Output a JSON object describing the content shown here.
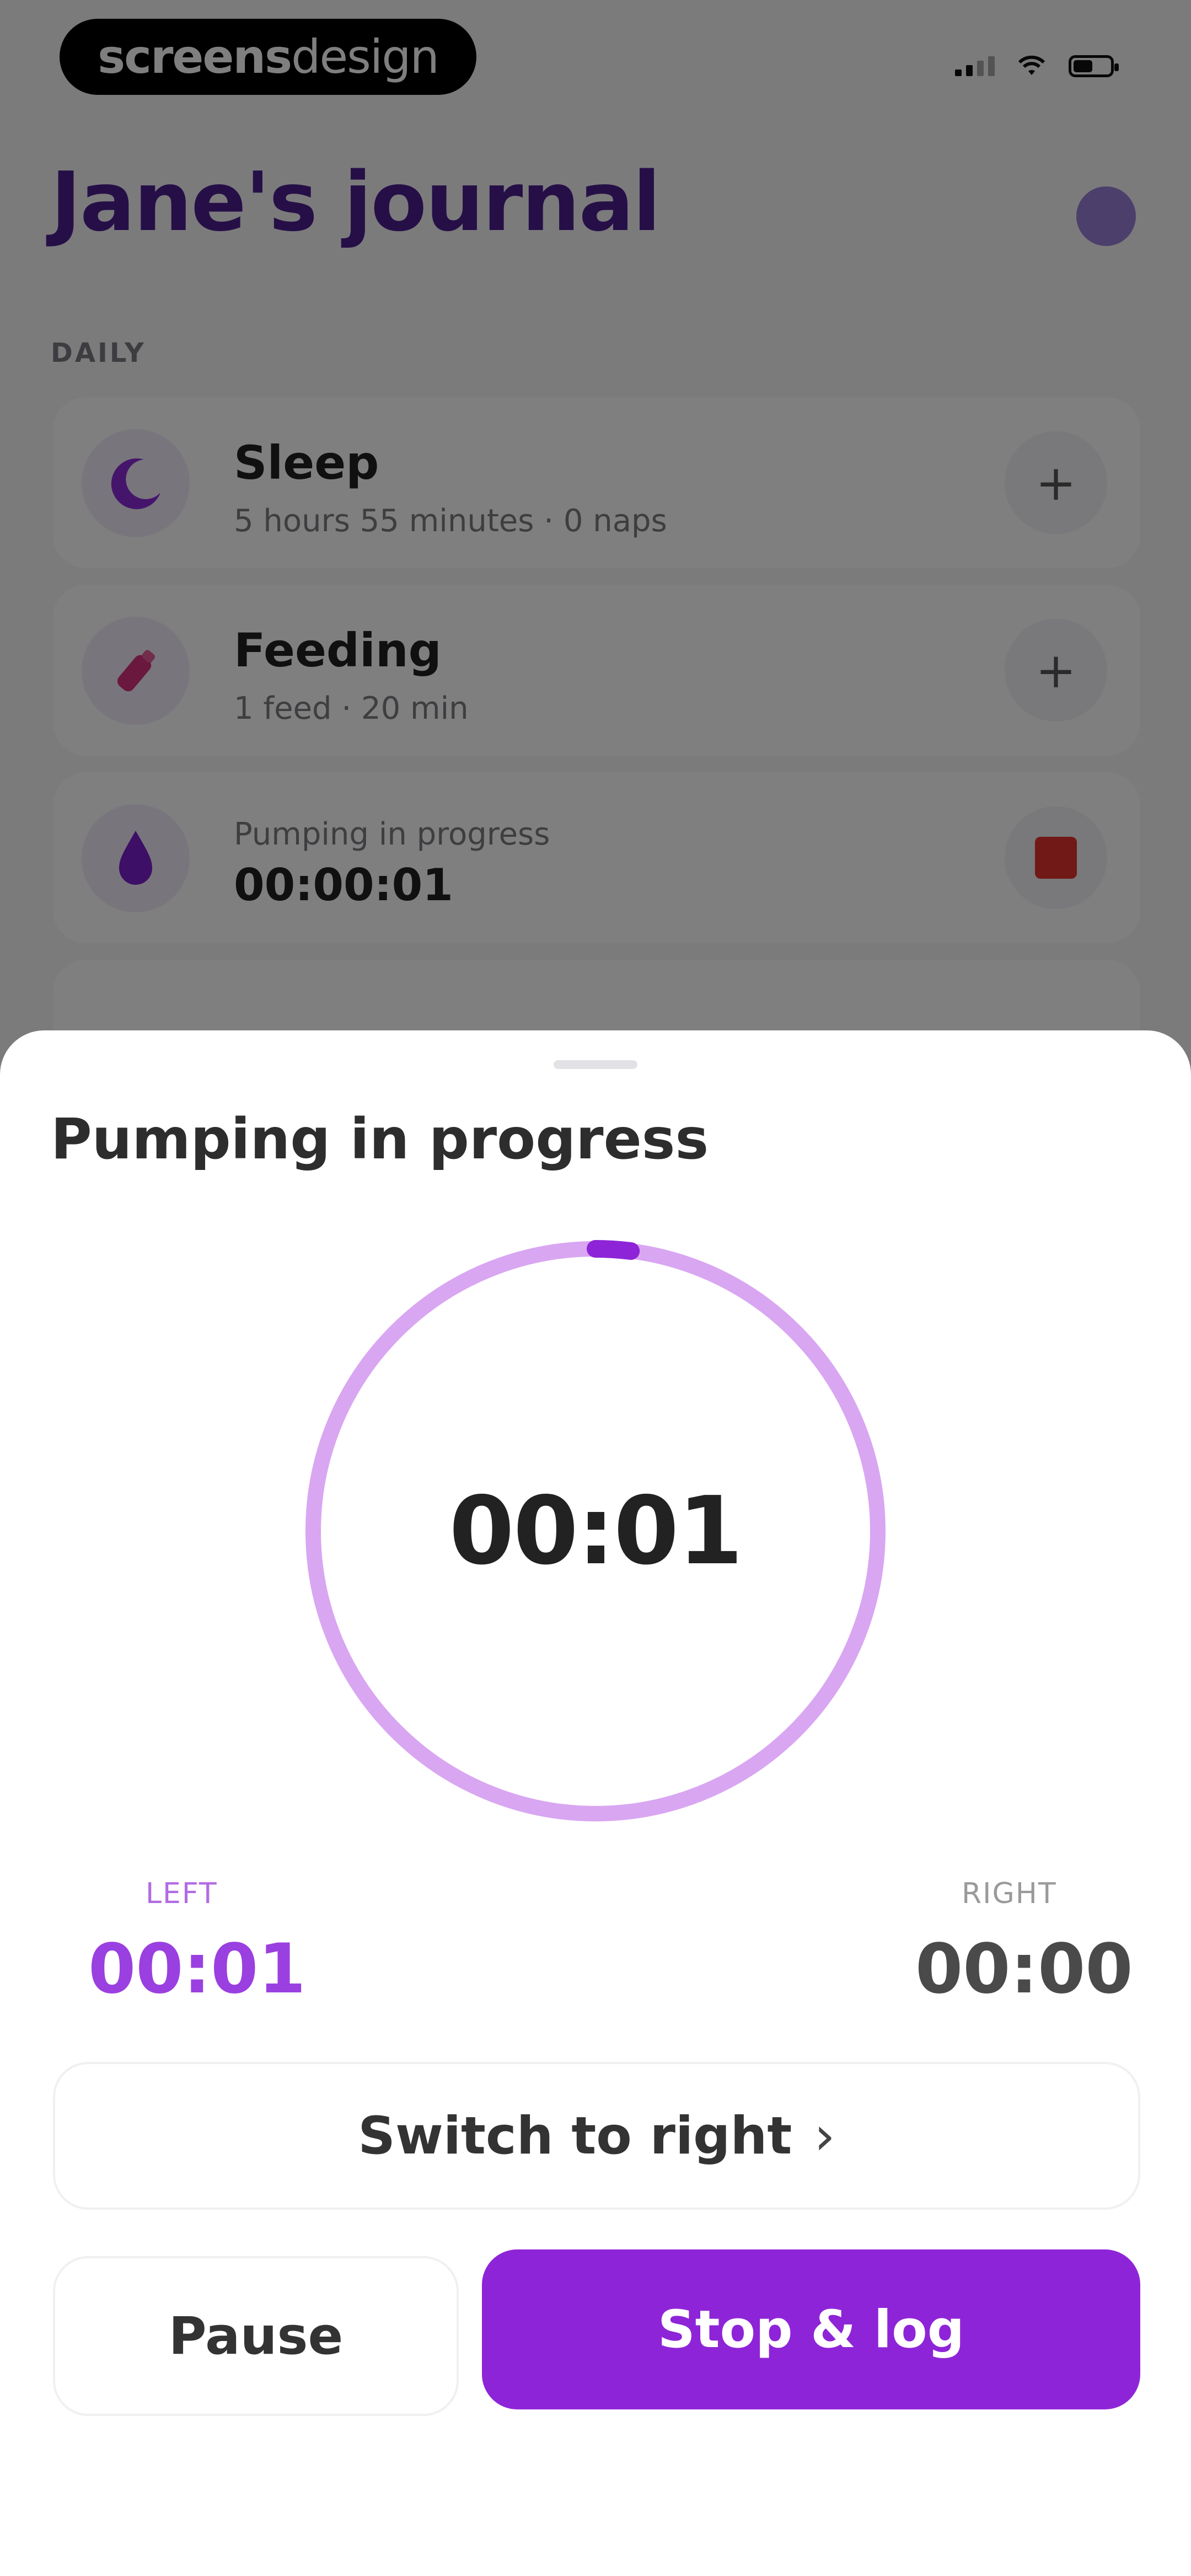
{
  "status_bar": {
    "brand_part1": "screens",
    "brand_part2": "design"
  },
  "journal": {
    "title": "Jane's journal",
    "section_label": "DAILY",
    "cards": [
      {
        "title": "Sleep",
        "subtitle": "5 hours 55 minutes · 0 naps",
        "icon": "moon-icon",
        "action": "plus"
      },
      {
        "title": "Feeding",
        "subtitle": "1 feed · 20 min",
        "icon": "bottle-icon",
        "action": "plus"
      },
      {
        "label": "Pumping in progress",
        "value": "00:00:01",
        "icon": "drop-icon",
        "action": "stop"
      }
    ],
    "plus_symbol": "+"
  },
  "sheet": {
    "title": "Pumping in progress",
    "timer": "00:01",
    "left_label": "LEFT",
    "left_time": "00:01",
    "right_label": "RIGHT",
    "right_time": "00:00",
    "switch_label": "Switch to right",
    "switch_chevron": "›",
    "pause_label": "Pause",
    "stop_label": "Stop & log",
    "progress_fraction": 0.02
  },
  "colors": {
    "accent": "#8e24d7",
    "ring": "#d9a6f2",
    "title_purple": "#4c1f8f",
    "stop_red": "#e0332f"
  }
}
